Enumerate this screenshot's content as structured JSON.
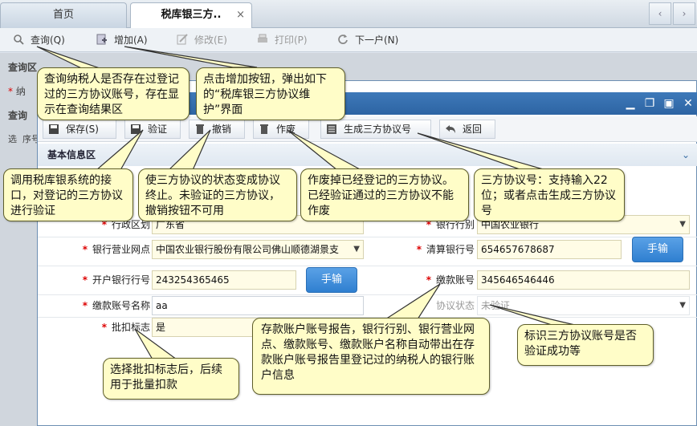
{
  "tabs": {
    "home": "首页",
    "active": "税库银三方..",
    "active_close": "×"
  },
  "bg_toolbar": {
    "query": "查询(Q)",
    "add": "增加(A)",
    "edit": "修改(E)",
    "print": "打印(P)",
    "next": "下一户(N)"
  },
  "bg_labels": {
    "query_area": "查询区",
    "required_prefix": "纳",
    "query_result": "查询",
    "col_select": "选",
    "col_seq": "序号"
  },
  "dialog": {
    "toolbar": {
      "save": "保存(S)",
      "verify": "验证",
      "cancel": "撤销",
      "void": "作废",
      "generate": "生成三方协议号",
      "back": "返回"
    },
    "section_title": "基本信息区",
    "form": {
      "row3_left_label_partial": "行政区划",
      "row3_left_value_partial": "广东省",
      "row3_right_label": "银行行别",
      "row3_right_value": "中国农业银行",
      "bank_outlet_label": "银行营业网点",
      "bank_outlet_value": "中国农业银行股份有限公司佛山顺德湖景支",
      "clearing_bank_label": "清算银行号",
      "clearing_bank_value": "654657678687",
      "manual_button": "手输",
      "open_bank_label": "开户银行行号",
      "open_bank_value": "243254365465",
      "account_label": "缴款账号",
      "account_value": "345646546446",
      "account_name_label": "缴款账号名称",
      "account_name_value": "aa",
      "agreement_status_label": "协议状态",
      "agreement_status_value": "未验证",
      "batch_flag_label": "批扣标志",
      "batch_flag_value": "是"
    }
  },
  "callouts": {
    "query": "查询纳税人是否存在过登记过的三方协议账号，存在显示在查询结果区",
    "add": "点击增加按钮，弹出如下的“税库银三方协议维护”界面",
    "verify": "调用税库银系统的接口，对登记的三方协议进行验证",
    "cancel": "使三方协议的状态变成协议终止。未验证的三方协议，撤销按钮不可用",
    "void": "作废掉已经登记的三方协议。已经验证通过的三方协议不能作废",
    "agreement_no": "三方协议号：支持输入22位；或者点击生成三方协议号",
    "account_report": "存款账户账号报告，银行行别、银行营业网点、缴款账号、缴款账户名称自动带出在存款账户账号报告里登记过的纳税人的银行账户信息",
    "status": "标识三方协议账号是否验证成功等",
    "batch": "选择批扣标志后，后续用于批量扣款"
  },
  "colors": {
    "title_bar": "#2d64a3",
    "callout_bg": "#fffdc8",
    "required": "#dd0000",
    "manual_button": "#2f7fd0"
  }
}
